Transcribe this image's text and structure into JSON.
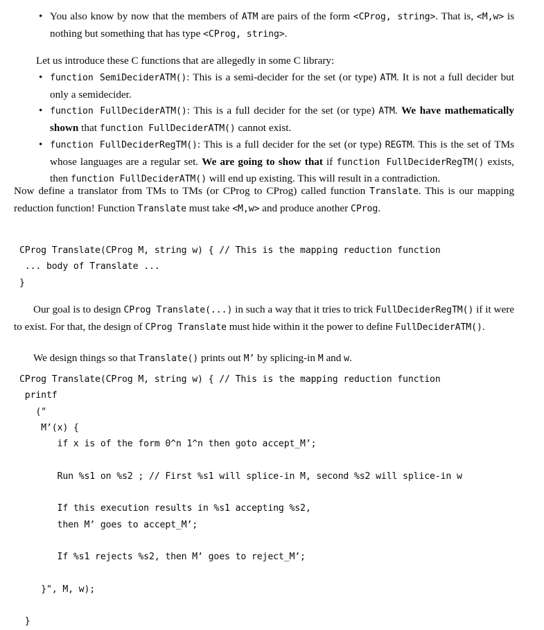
{
  "document": {
    "type": "lecture-notes",
    "topic": "Mapping reduction from ATM to REGTM"
  },
  "intro_bullets": [
    {
      "bullet": "•",
      "segments": [
        {
          "kind": "text",
          "text": "You also know by now that the members of "
        },
        {
          "kind": "code",
          "text": "ATM"
        },
        {
          "kind": "text",
          "text": " are pairs of the form "
        },
        {
          "kind": "code",
          "text": "<CProg, string>"
        },
        {
          "kind": "text",
          "text": ". That is, "
        },
        {
          "kind": "code",
          "text": "<M,w>"
        },
        {
          "kind": "text",
          "text": " is nothing but something that has type "
        },
        {
          "kind": "code",
          "text": "<CProg, string>"
        },
        {
          "kind": "text",
          "text": "."
        }
      ]
    }
  ],
  "lead_in": "Let us introduce these C functions that are allegedly in some C library:",
  "function_bullets": [
    {
      "bullet": "•",
      "segments": [
        {
          "kind": "code",
          "text": "function SemiDeciderATM()"
        },
        {
          "kind": "text",
          "text": ": This is a semi-decider for the set (or type) "
        },
        {
          "kind": "code",
          "text": "ATM"
        },
        {
          "kind": "text",
          "text": ". It is not a full decider but only a semidecider."
        }
      ]
    },
    {
      "bullet": "•",
      "segments": [
        {
          "kind": "code",
          "text": "function FullDeciderATM()"
        },
        {
          "kind": "text",
          "text": ": This is a full decider for the set (or type) "
        },
        {
          "kind": "code",
          "text": "ATM"
        },
        {
          "kind": "text",
          "text": ". "
        },
        {
          "kind": "bold",
          "text": "We have mathematically shown"
        },
        {
          "kind": "text",
          "text": " that "
        },
        {
          "kind": "code",
          "text": "function FullDeciderATM()"
        },
        {
          "kind": "text",
          "text": " cannot exist."
        }
      ]
    },
    {
      "bullet": "•",
      "segments": [
        {
          "kind": "code",
          "text": "function FullDeciderRegTM()"
        },
        {
          "kind": "text",
          "text": ": This is a full decider for the set (or type) "
        },
        {
          "kind": "code",
          "text": "REGTM"
        },
        {
          "kind": "text",
          "text": ". This is the set of TMs whose languages are a regular set. "
        },
        {
          "kind": "bold",
          "text": "We are going to show that"
        },
        {
          "kind": "text",
          "text": " if "
        },
        {
          "kind": "code",
          "text": "function FullDeciderRegTM()"
        },
        {
          "kind": "text",
          "text": " exists, then "
        },
        {
          "kind": "code",
          "text": "function FullDeciderATM()"
        },
        {
          "kind": "text",
          "text": " will end up existing. This will result in a contradiction."
        }
      ]
    }
  ],
  "translate_paragraph": {
    "segments": [
      {
        "kind": "text",
        "text": "Now define a translator from TMs to TMs (or CProg to CProg) called function "
      },
      {
        "kind": "code",
        "text": "Translate"
      },
      {
        "kind": "text",
        "text": ". This is our mapping reduction function! Function "
      },
      {
        "kind": "code",
        "text": "Translate"
      },
      {
        "kind": "text",
        "text": " must take "
      },
      {
        "kind": "code",
        "text": "<M,w>"
      },
      {
        "kind": "text",
        "text": " and produce another "
      },
      {
        "kind": "code",
        "text": "CProg"
      },
      {
        "kind": "text",
        "text": "."
      }
    ]
  },
  "code_block_1": {
    "name": "translate-skeleton",
    "lines": [
      "CProg Translate(CProg M, string w) { // This is the mapping reduction function",
      " ... body of Translate ...",
      "}"
    ]
  },
  "goal_paragraph": {
    "segments": [
      {
        "kind": "text",
        "text": "Our goal is to design "
      },
      {
        "kind": "code",
        "text": "CProg Translate(...)"
      },
      {
        "kind": "text",
        "text": " in such a way that it tries to trick "
      },
      {
        "kind": "code",
        "text": "FullDeciderRegTM()"
      },
      {
        "kind": "text",
        "text": " if it were to exist. For that, the design of "
      },
      {
        "kind": "code",
        "text": "CProg Translate"
      },
      {
        "kind": "text",
        "text": " must hide within it the power to define "
      },
      {
        "kind": "code",
        "text": "FullDeciderATM()"
      },
      {
        "kind": "text",
        "text": "."
      }
    ]
  },
  "design_paragraph": {
    "segments": [
      {
        "kind": "text",
        "text": "We design things so that "
      },
      {
        "kind": "code",
        "text": "Translate()"
      },
      {
        "kind": "text",
        "text": " prints out "
      },
      {
        "kind": "code",
        "text": "M’"
      },
      {
        "kind": "text",
        "text": " by splicing-in "
      },
      {
        "kind": "code",
        "text": "M"
      },
      {
        "kind": "text",
        "text": " and "
      },
      {
        "kind": "code",
        "text": "w"
      },
      {
        "kind": "text",
        "text": "."
      }
    ]
  },
  "code_block_2": {
    "name": "translate-full-body",
    "lines": [
      "CProg Translate(CProg M, string w) { // This is the mapping reduction function",
      " printf",
      "   (\"",
      "    M’(x) {",
      "       if x is of the form 0^n 1^n then goto accept_M’;",
      "",
      "       Run %s1 on %s2 ; // First %s1 will splice-in M, second %s2 will splice-in w",
      "",
      "       If this execution results in %s1 accepting %s2,",
      "       then M’ goes to accept_M’;",
      "",
      "       If %s1 rejects %s2, then M’ goes to reject_M’;",
      "",
      "    }\", M, w);",
      "",
      " }"
    ]
  },
  "colors": {
    "page_background": "#ffffff",
    "text": "#0a0a0a"
  }
}
